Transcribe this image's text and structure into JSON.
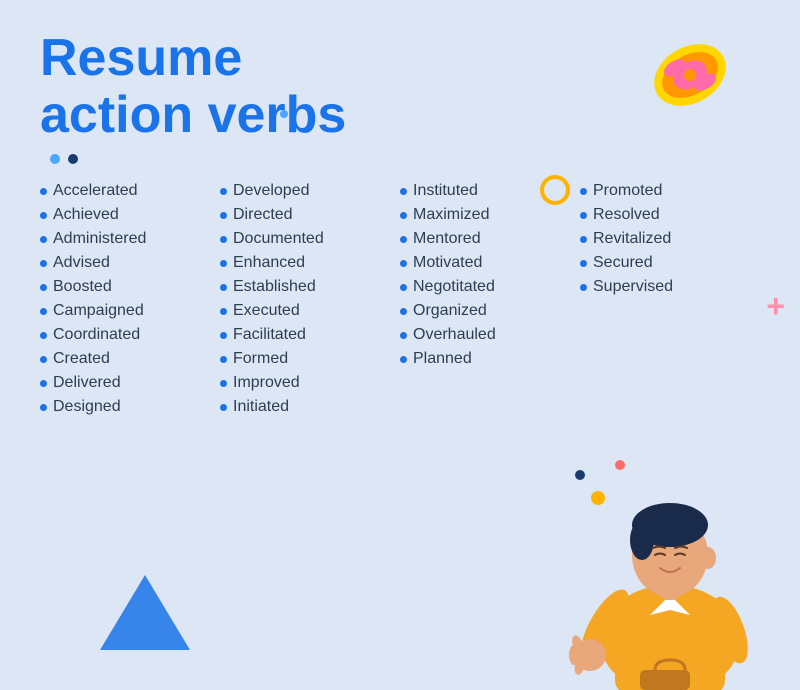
{
  "page": {
    "title_line1": "Resume",
    "title_line2": "action verbs",
    "background_color": "#dce6f5",
    "accent_color": "#1a73e8"
  },
  "columns": [
    {
      "id": "col1",
      "items": [
        "Accelerated",
        "Achieved",
        "Administered",
        "Advised",
        "Boosted",
        "Campaigned",
        "Coordinated",
        "Created",
        "Delivered",
        "Designed"
      ]
    },
    {
      "id": "col2",
      "items": [
        "Developed",
        "Directed",
        "Documented",
        "Enhanced",
        "Established",
        "Executed",
        "Facilitated",
        "Formed",
        "Improved",
        "Initiated"
      ]
    },
    {
      "id": "col3",
      "items": [
        "Instituted",
        "Maximized",
        "Mentored",
        "Motivated",
        "Negotitated",
        "Organized",
        "Overhauled",
        "Planned"
      ]
    },
    {
      "id": "col4",
      "items": [
        "Promoted",
        "Resolved",
        "Revitalized",
        "Secured",
        "Supervised"
      ]
    }
  ]
}
